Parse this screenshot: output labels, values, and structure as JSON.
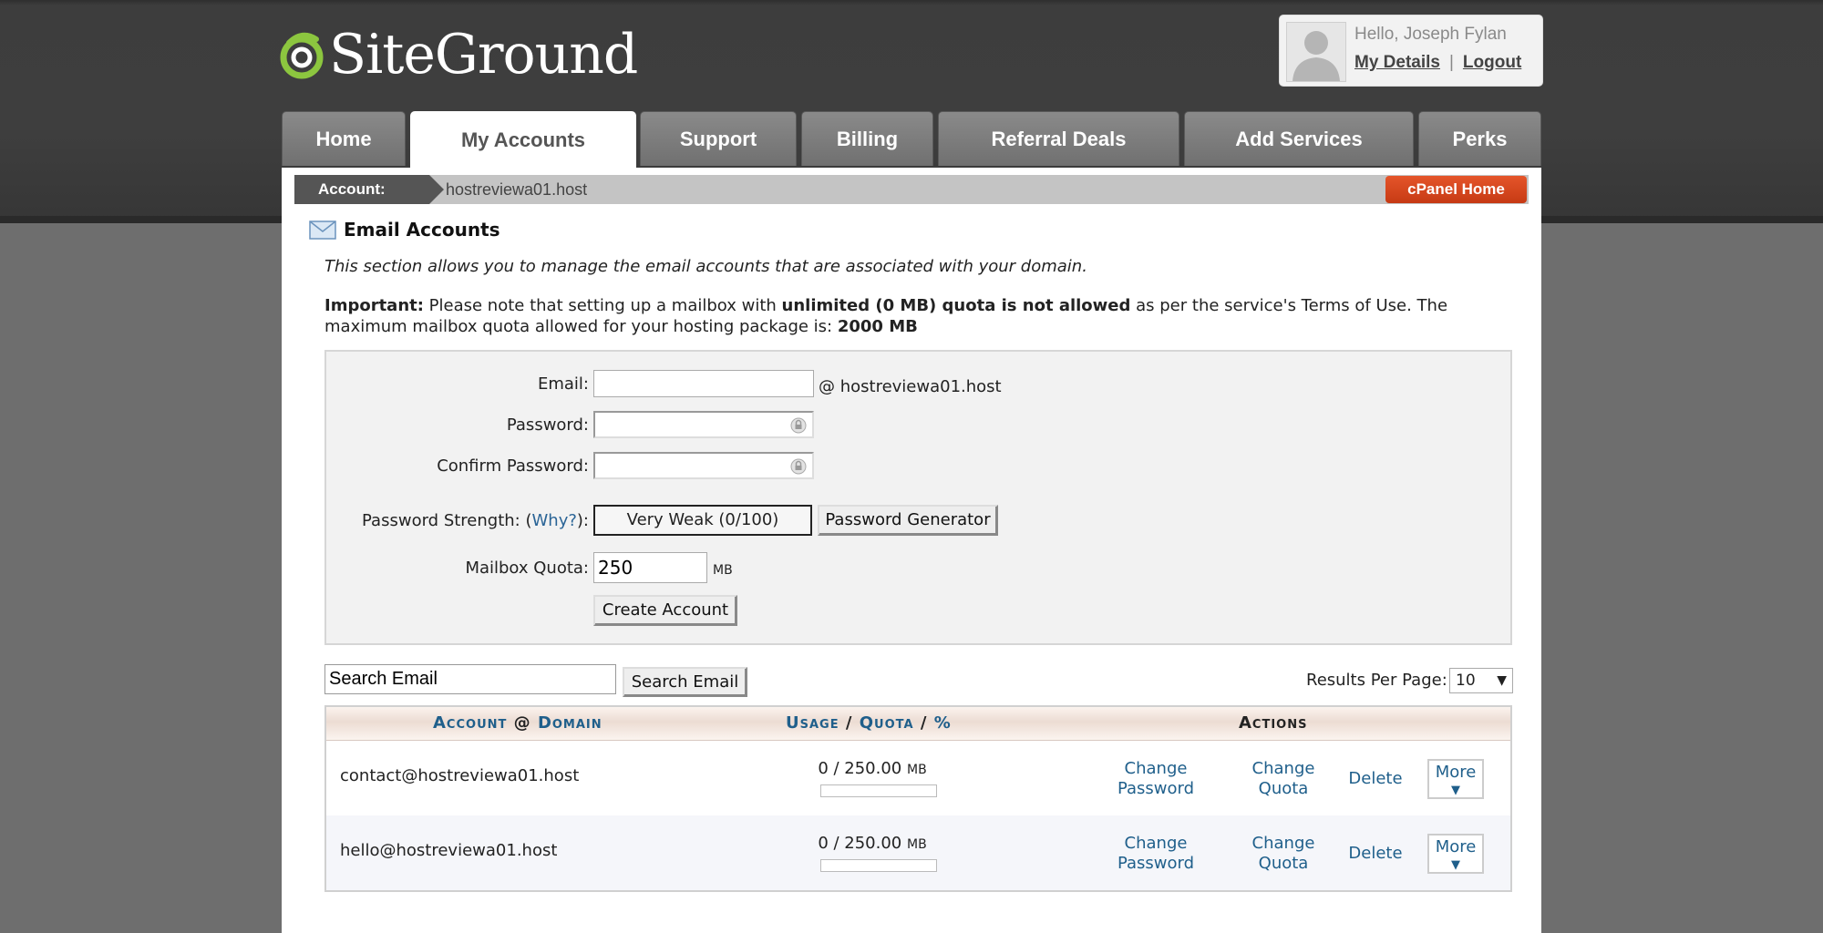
{
  "brand": {
    "name": "SiteGround"
  },
  "user": {
    "greeting": "Hello, Joseph Fylan",
    "my_details": "My Details",
    "separator": "|",
    "logout": "Logout"
  },
  "tabs": [
    {
      "label": "Home"
    },
    {
      "label": "My Accounts",
      "active": true
    },
    {
      "label": "Support"
    },
    {
      "label": "Billing"
    },
    {
      "label": "Referral Deals"
    },
    {
      "label": "Add Services"
    },
    {
      "label": "Perks"
    }
  ],
  "breadcrumb": {
    "label": "Account:",
    "value": "hostreviewa01.host",
    "cpanel_button": "cPanel Home"
  },
  "section": {
    "title": "Email Accounts",
    "intro": "This section allows you to manage the email accounts that are associated with your domain.",
    "important_label": "Important:",
    "important_text_1": " Please note that setting up a mailbox with ",
    "important_bold": "unlimited (0 MB) quota is not allowed",
    "important_text_2": " as per the service's Terms of Use. The maximum mailbox quota allowed for your hosting package is: ",
    "important_max": "2000 MB"
  },
  "form": {
    "email_label": "Email:",
    "email_value": "",
    "domain_suffix": "@ hostreviewa01.host",
    "password_label": "Password:",
    "confirm_label": "Confirm Password:",
    "strength_label_pre": "Password Strength: (",
    "strength_why": "Why?",
    "strength_label_post": "):",
    "strength_value": "Very Weak (0/100)",
    "generator_button": "Password Generator",
    "quota_label": "Mailbox Quota:",
    "quota_value": "250",
    "quota_unit": "MB",
    "create_button": "Create Account"
  },
  "search": {
    "value": "Search Email",
    "button": "Search Email",
    "rpp_label": "Results Per Page:",
    "rpp_value": "10"
  },
  "table": {
    "headers": {
      "account": "Account",
      "at": "@",
      "domain": "Domain",
      "usage": "Usage",
      "slash1": "/",
      "quota": "Quota",
      "slash2": "/",
      "percent": "%",
      "actions": "Actions"
    },
    "rows": [
      {
        "email": "contact@hostreviewa01.host",
        "usage": "0 / 250.00",
        "unit": "MB",
        "usage_fraction": 0
      },
      {
        "email": "hello@hostreviewa01.host",
        "usage": "0 / 250.00",
        "unit": "MB",
        "usage_fraction": 0
      }
    ],
    "actions": {
      "change_password_1": "Change",
      "change_password_2": "Password",
      "change_quota_1": "Change",
      "change_quota_2": "Quota",
      "delete": "Delete",
      "more": "More",
      "more_arrow": "▼"
    }
  },
  "colors": {
    "accent_orange": "#d2441b",
    "link_blue": "#1f5f8b",
    "logo_green": "#8cc63f"
  }
}
